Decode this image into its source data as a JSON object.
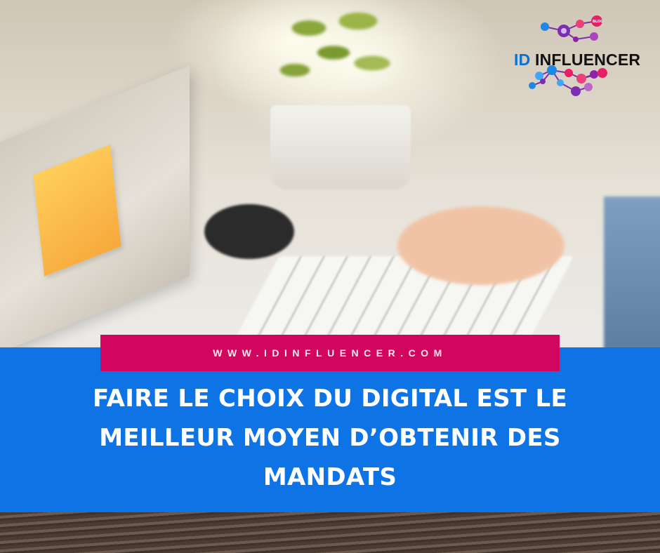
{
  "logo": {
    "id_text": "ID",
    "name_text": "INFLUENCER",
    "blog_badge": "BLOG"
  },
  "url_text": "WWW.IDINFLUENCER.COM",
  "headline": {
    "line1": "FAIRE LE CHOIX DU DIGITAL EST LE",
    "line2": "MEILLEUR MOYEN D’OBTENIR DES",
    "line3": "MANDATS"
  },
  "colors": {
    "banner_blue": "#0e74e6",
    "url_bar_magenta": "#d1075f",
    "logo_id_blue": "#0a6fd6",
    "network_purple": "#7b2fb0"
  }
}
